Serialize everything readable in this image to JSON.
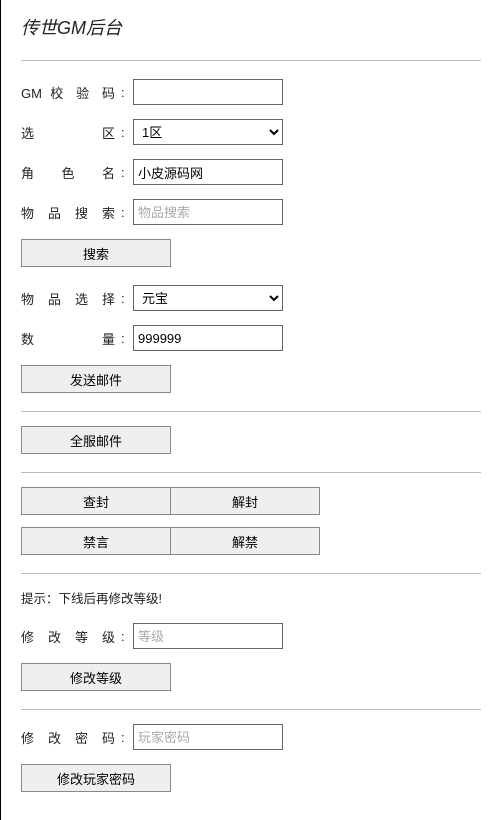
{
  "title": "传世GM后台",
  "section1": {
    "gm_code_label": "GM 校 验 码",
    "gm_code_value": "",
    "zone_label": "选　　区",
    "zone_selected": "1区",
    "role_name_label": "角　色　名",
    "role_name_value": "小皮源码网",
    "item_search_label": "物 品 搜 索",
    "item_search_placeholder": "物品搜索",
    "item_search_value": "",
    "search_btn": "搜索",
    "item_select_label": "物 品 选 择",
    "item_selected": "元宝",
    "quantity_label": "数　　量",
    "quantity_value": "999999",
    "send_mail_btn": "发送邮件"
  },
  "section2": {
    "server_mail_btn": "全服邮件"
  },
  "section3": {
    "btn_block": "查封",
    "btn_unblock": "解封",
    "btn_mute": "禁言",
    "btn_unmute": "解禁"
  },
  "section4": {
    "hint": "提示：下线后再修改等级!",
    "level_label": "修 改 等 级",
    "level_placeholder": "等级",
    "level_value": "",
    "modify_level_btn": "修改等级"
  },
  "section5": {
    "password_label": "修 改 密 码",
    "password_placeholder": "玩家密码",
    "password_value": "",
    "modify_password_btn": "修改玩家密码"
  }
}
